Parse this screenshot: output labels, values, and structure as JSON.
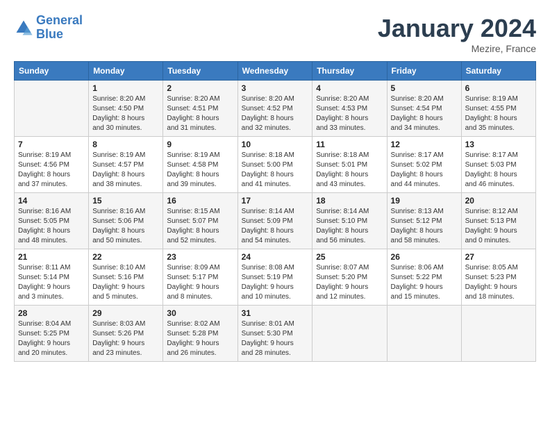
{
  "header": {
    "logo_line1": "General",
    "logo_line2": "Blue",
    "month_title": "January 2024",
    "location": "Mezire, France"
  },
  "days_of_week": [
    "Sunday",
    "Monday",
    "Tuesday",
    "Wednesday",
    "Thursday",
    "Friday",
    "Saturday"
  ],
  "weeks": [
    [
      {
        "day": "",
        "info": ""
      },
      {
        "day": "1",
        "info": "Sunrise: 8:20 AM\nSunset: 4:50 PM\nDaylight: 8 hours\nand 30 minutes."
      },
      {
        "day": "2",
        "info": "Sunrise: 8:20 AM\nSunset: 4:51 PM\nDaylight: 8 hours\nand 31 minutes."
      },
      {
        "day": "3",
        "info": "Sunrise: 8:20 AM\nSunset: 4:52 PM\nDaylight: 8 hours\nand 32 minutes."
      },
      {
        "day": "4",
        "info": "Sunrise: 8:20 AM\nSunset: 4:53 PM\nDaylight: 8 hours\nand 33 minutes."
      },
      {
        "day": "5",
        "info": "Sunrise: 8:20 AM\nSunset: 4:54 PM\nDaylight: 8 hours\nand 34 minutes."
      },
      {
        "day": "6",
        "info": "Sunrise: 8:19 AM\nSunset: 4:55 PM\nDaylight: 8 hours\nand 35 minutes."
      }
    ],
    [
      {
        "day": "7",
        "info": "Sunrise: 8:19 AM\nSunset: 4:56 PM\nDaylight: 8 hours\nand 37 minutes."
      },
      {
        "day": "8",
        "info": "Sunrise: 8:19 AM\nSunset: 4:57 PM\nDaylight: 8 hours\nand 38 minutes."
      },
      {
        "day": "9",
        "info": "Sunrise: 8:19 AM\nSunset: 4:58 PM\nDaylight: 8 hours\nand 39 minutes."
      },
      {
        "day": "10",
        "info": "Sunrise: 8:18 AM\nSunset: 5:00 PM\nDaylight: 8 hours\nand 41 minutes."
      },
      {
        "day": "11",
        "info": "Sunrise: 8:18 AM\nSunset: 5:01 PM\nDaylight: 8 hours\nand 43 minutes."
      },
      {
        "day": "12",
        "info": "Sunrise: 8:17 AM\nSunset: 5:02 PM\nDaylight: 8 hours\nand 44 minutes."
      },
      {
        "day": "13",
        "info": "Sunrise: 8:17 AM\nSunset: 5:03 PM\nDaylight: 8 hours\nand 46 minutes."
      }
    ],
    [
      {
        "day": "14",
        "info": "Sunrise: 8:16 AM\nSunset: 5:05 PM\nDaylight: 8 hours\nand 48 minutes."
      },
      {
        "day": "15",
        "info": "Sunrise: 8:16 AM\nSunset: 5:06 PM\nDaylight: 8 hours\nand 50 minutes."
      },
      {
        "day": "16",
        "info": "Sunrise: 8:15 AM\nSunset: 5:07 PM\nDaylight: 8 hours\nand 52 minutes."
      },
      {
        "day": "17",
        "info": "Sunrise: 8:14 AM\nSunset: 5:09 PM\nDaylight: 8 hours\nand 54 minutes."
      },
      {
        "day": "18",
        "info": "Sunrise: 8:14 AM\nSunset: 5:10 PM\nDaylight: 8 hours\nand 56 minutes."
      },
      {
        "day": "19",
        "info": "Sunrise: 8:13 AM\nSunset: 5:12 PM\nDaylight: 8 hours\nand 58 minutes."
      },
      {
        "day": "20",
        "info": "Sunrise: 8:12 AM\nSunset: 5:13 PM\nDaylight: 9 hours\nand 0 minutes."
      }
    ],
    [
      {
        "day": "21",
        "info": "Sunrise: 8:11 AM\nSunset: 5:14 PM\nDaylight: 9 hours\nand 3 minutes."
      },
      {
        "day": "22",
        "info": "Sunrise: 8:10 AM\nSunset: 5:16 PM\nDaylight: 9 hours\nand 5 minutes."
      },
      {
        "day": "23",
        "info": "Sunrise: 8:09 AM\nSunset: 5:17 PM\nDaylight: 9 hours\nand 8 minutes."
      },
      {
        "day": "24",
        "info": "Sunrise: 8:08 AM\nSunset: 5:19 PM\nDaylight: 9 hours\nand 10 minutes."
      },
      {
        "day": "25",
        "info": "Sunrise: 8:07 AM\nSunset: 5:20 PM\nDaylight: 9 hours\nand 12 minutes."
      },
      {
        "day": "26",
        "info": "Sunrise: 8:06 AM\nSunset: 5:22 PM\nDaylight: 9 hours\nand 15 minutes."
      },
      {
        "day": "27",
        "info": "Sunrise: 8:05 AM\nSunset: 5:23 PM\nDaylight: 9 hours\nand 18 minutes."
      }
    ],
    [
      {
        "day": "28",
        "info": "Sunrise: 8:04 AM\nSunset: 5:25 PM\nDaylight: 9 hours\nand 20 minutes."
      },
      {
        "day": "29",
        "info": "Sunrise: 8:03 AM\nSunset: 5:26 PM\nDaylight: 9 hours\nand 23 minutes."
      },
      {
        "day": "30",
        "info": "Sunrise: 8:02 AM\nSunset: 5:28 PM\nDaylight: 9 hours\nand 26 minutes."
      },
      {
        "day": "31",
        "info": "Sunrise: 8:01 AM\nSunset: 5:30 PM\nDaylight: 9 hours\nand 28 minutes."
      },
      {
        "day": "",
        "info": ""
      },
      {
        "day": "",
        "info": ""
      },
      {
        "day": "",
        "info": ""
      }
    ]
  ]
}
